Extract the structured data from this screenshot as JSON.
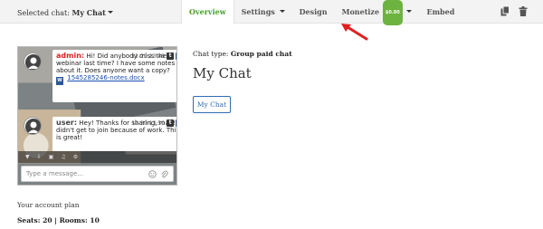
{
  "topbar": {
    "selected_label": "Selected chat:",
    "selected_value": "My Chat",
    "nav": [
      {
        "label": "Overview",
        "active": true
      },
      {
        "label": "Settings",
        "dropdown": true
      },
      {
        "label": "Design"
      },
      {
        "label": "Monetize",
        "badge": "$0.00",
        "dropdown": true
      },
      {
        "label": "Embed"
      }
    ],
    "icons": [
      "copy-icon",
      "trash-icon"
    ]
  },
  "widget": {
    "messages": [
      {
        "user": "admin:",
        "text": "Hi! Did anybody miss the webinar last time? I have some notes about it. Does anyone want a copy?",
        "time": "12-20 13:48",
        "file": "1545285246-notes.docx"
      },
      {
        "user": "user:",
        "text": "Hey! Thanks for sharing, man! I didn't get to join because of work. This is great!",
        "time": "12-20 13:50"
      }
    ],
    "input_placeholder": "Type a message..."
  },
  "main": {
    "chat_type_label": "Chat type:",
    "chat_type_value": "Group paid chat",
    "title": "My Chat",
    "button_label": "My Chat"
  },
  "plan": {
    "label": "Your account plan",
    "seats_label": "Seats:",
    "seats_value": "20",
    "rooms_label": "Rooms:",
    "rooms_value": "10"
  },
  "colors": {
    "active_tab": "#4aa02c",
    "badge": "#6db33f",
    "arrow": "#e02020",
    "button_border": "#2e6db4"
  }
}
